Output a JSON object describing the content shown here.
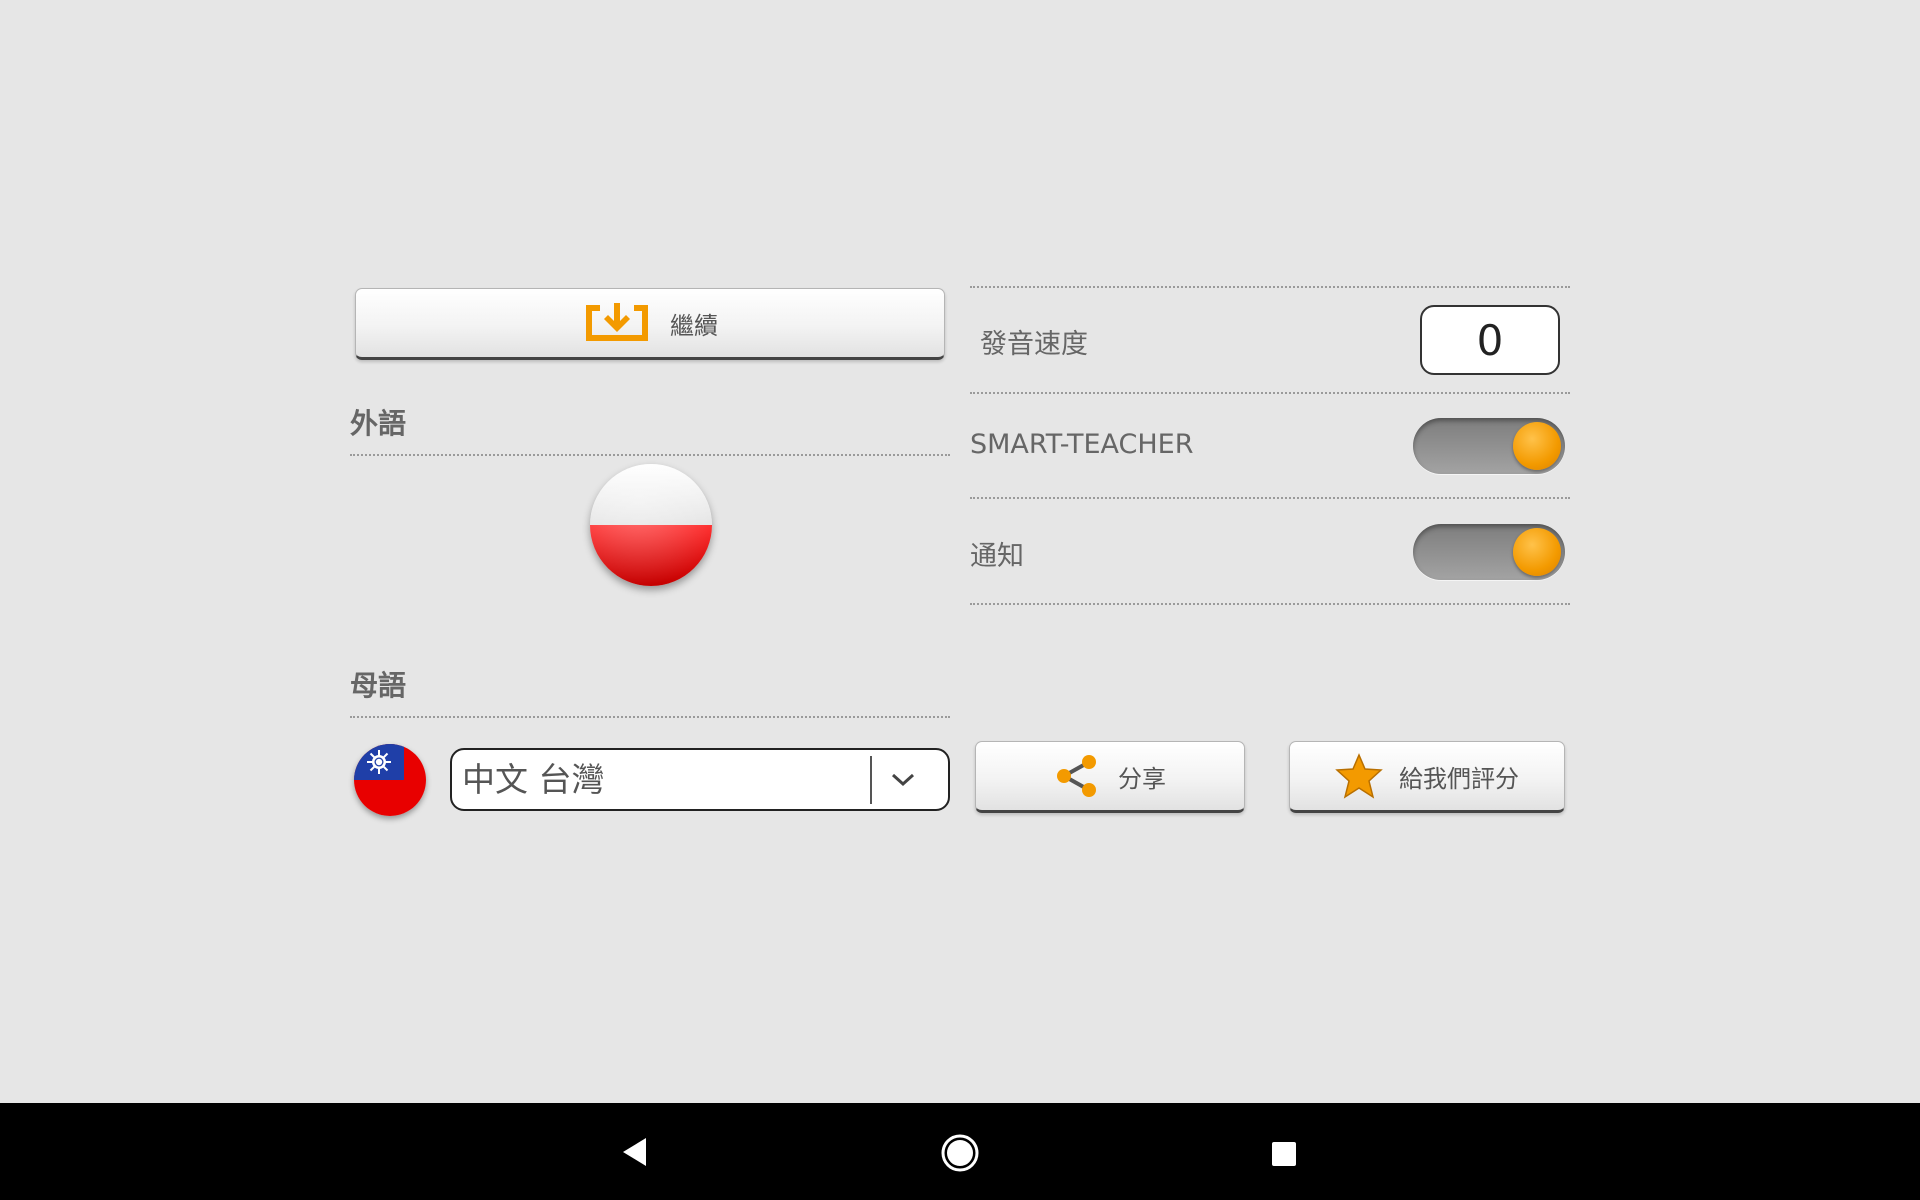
{
  "continue_button": {
    "label": "繼續",
    "icon": "download-tray-icon"
  },
  "foreign_language": {
    "title": "外語",
    "flag": "poland-flag"
  },
  "native_language": {
    "title": "母語",
    "flag": "taiwan-flag",
    "selected": "中文 台灣"
  },
  "settings": {
    "speed_label": "發音速度",
    "speed_value": "0",
    "smart_teacher_label": "SMART-TEACHER",
    "smart_teacher_on": true,
    "notification_label": "通知",
    "notification_on": true
  },
  "share_button": {
    "label": "分享",
    "icon": "share-icon"
  },
  "rate_button": {
    "label": "給我們評分",
    "icon": "star-icon"
  },
  "navbar": {
    "back": "back-icon",
    "home": "home-icon",
    "recents": "recents-icon"
  },
  "colors": {
    "accent": "#f39a00",
    "background": "#e6e6e6"
  }
}
